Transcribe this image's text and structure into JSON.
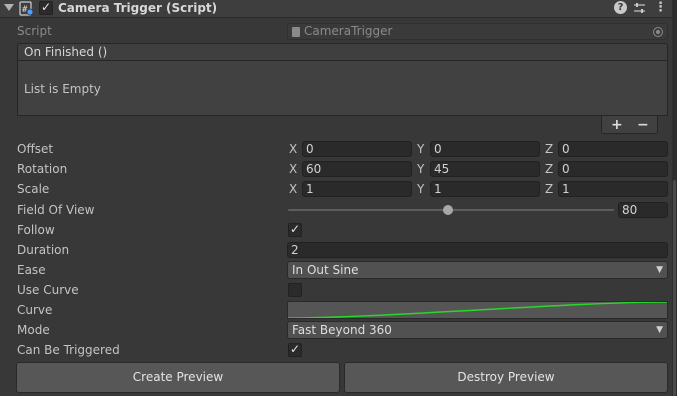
{
  "component": {
    "title": "Camera Trigger (Script)",
    "enabled": true,
    "icons": [
      "foldout-arrow-icon",
      "script-icon",
      "help-icon",
      "preset-icon",
      "more-options-icon"
    ]
  },
  "script_field": {
    "label": "Script",
    "value": "CameraTrigger"
  },
  "event": {
    "title": "On Finished ()",
    "empty_text": "List is Empty",
    "add_label": "+",
    "remove_label": "−"
  },
  "offset": {
    "label": "Offset",
    "x": "0",
    "y": "0",
    "z": "0"
  },
  "rotation": {
    "label": "Rotation",
    "x": "60",
    "y": "45",
    "z": "0"
  },
  "scale": {
    "label": "Scale",
    "x": "1",
    "y": "1",
    "z": "1"
  },
  "axis_labels": {
    "x": "X",
    "y": "Y",
    "z": "Z"
  },
  "field_of_view": {
    "label": "Field Of View",
    "value": "80",
    "slider_fraction": 0.49
  },
  "follow": {
    "label": "Follow",
    "checked": true
  },
  "duration": {
    "label": "Duration",
    "value": "2"
  },
  "ease": {
    "label": "Ease",
    "value": "In Out Sine"
  },
  "use_curve": {
    "label": "Use Curve",
    "checked": false
  },
  "curve": {
    "label": "Curve",
    "line_color": "#28d828"
  },
  "mode": {
    "label": "Mode",
    "value": "Fast Beyond 360"
  },
  "can_be_triggered": {
    "label": "Can Be Triggered",
    "checked": true
  },
  "buttons": {
    "create_preview": "Create Preview",
    "destroy_preview": "Destroy Preview"
  },
  "colors": {
    "background": "#383838",
    "field": "#2a2a2a",
    "button": "#575757",
    "text": "#c4c4c4"
  }
}
